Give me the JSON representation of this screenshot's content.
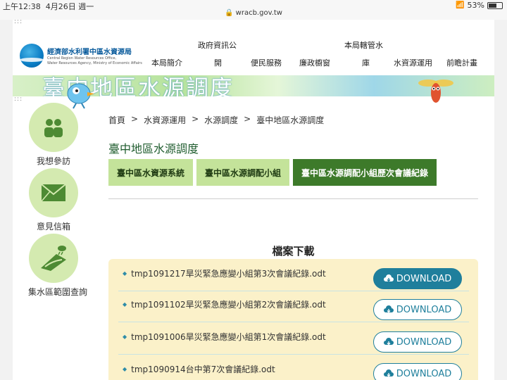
{
  "status": {
    "time": "上午12:38",
    "date": "4月26日 週一",
    "url": "wracb.gov.tw",
    "battery": "53%"
  },
  "logo": {
    "name": "經濟部水利署中區水資源局",
    "en_line1": "Central Region Water Resources Office,",
    "en_line2": "Water Resources Agency, Ministry of Economic Affairs"
  },
  "nav": {
    "items": [
      {
        "top": "",
        "label": "本局簡介"
      },
      {
        "top": "政府資訊公",
        "label": "開"
      },
      {
        "top": "",
        "label": "便民服務"
      },
      {
        "top": "",
        "label": "廉政櫥窗"
      },
      {
        "top": "本局轄管水",
        "label": "庫"
      },
      {
        "top": "",
        "label": "水資源運用"
      },
      {
        "top": "",
        "label": "前瞻計畫"
      }
    ]
  },
  "banner": {
    "title": "臺中地區水源調度"
  },
  "side": [
    {
      "label": "我想參訪",
      "icon": "people-icon"
    },
    {
      "label": "意見信箱",
      "icon": "mail-icon"
    },
    {
      "label": "集水區範圍查詢",
      "icon": "watershed-icon"
    }
  ],
  "breadcrumb": [
    "首頁",
    "水資源運用",
    "水源調度",
    "臺中地區水源調度"
  ],
  "page_title": "臺中地區水源調度",
  "tabs": [
    {
      "label": "臺中區水資源系統",
      "active": false
    },
    {
      "label": "臺中區水源調配小組",
      "active": false
    },
    {
      "label": "臺中區水源調配小組歷次會議紀錄",
      "active": true
    }
  ],
  "download_title": "檔案下載",
  "files": [
    {
      "name": "tmp1091217旱災緊急應變小組第3次會議紀錄.odt",
      "button": "DOWNLOAD",
      "filled": true
    },
    {
      "name": "tmp1091102旱災緊急應變小組第2次會議紀錄.odt",
      "button": "DOWNLOAD",
      "filled": false
    },
    {
      "name": "tmp1091006旱災緊急應變小組第1次會議紀錄.odt",
      "button": "DOWNLOAD",
      "filled": false
    },
    {
      "name": "tmp1090914台中第7次會議紀錄.odt",
      "button": "DOWNLOAD",
      "filled": false
    }
  ],
  "colors": {
    "accent": "#1f7f9c",
    "tab_active": "#3d7a2a",
    "tab": "#c4e39a",
    "download_bg": "#fbf1c9"
  }
}
